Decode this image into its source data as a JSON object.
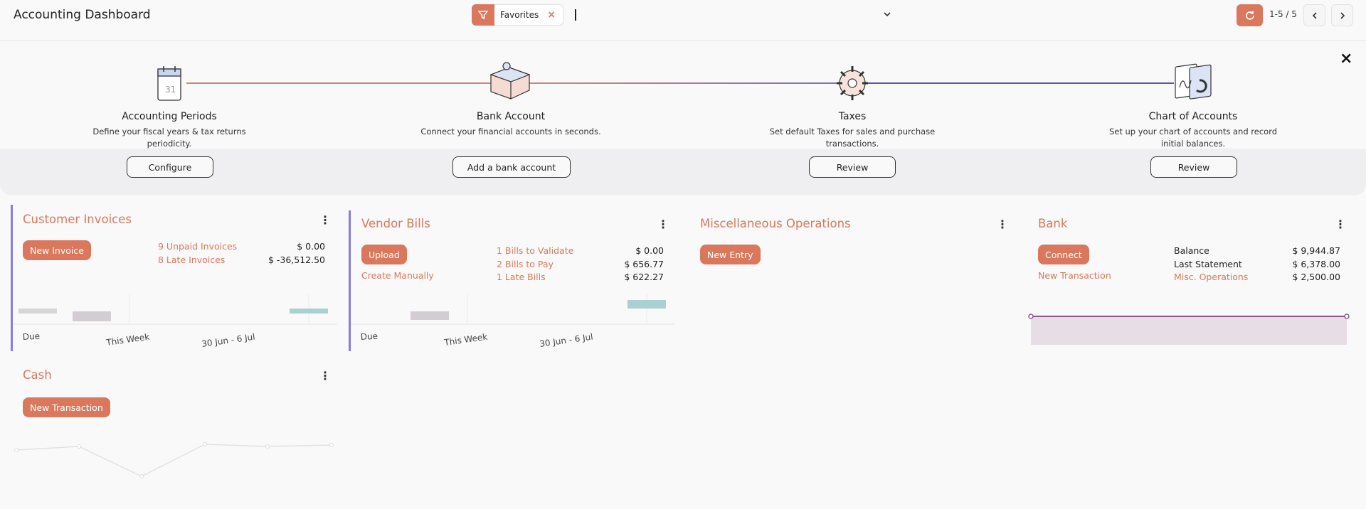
{
  "header": {
    "title": "Accounting Dashboard",
    "facet_label": "Favorites",
    "facet_remove": "×",
    "pager_value": "1-5 / 5"
  },
  "onboarding": {
    "close": "×",
    "steps": [
      {
        "title": "Accounting Periods",
        "desc": "Define your fiscal years & tax returns periodicity.",
        "button": "Configure"
      },
      {
        "title": "Bank Account",
        "desc": "Connect your financial accounts in seconds.",
        "button": "Add a bank account"
      },
      {
        "title": "Taxes",
        "desc": "Set default Taxes for sales and purchase transactions.",
        "button": "Review"
      },
      {
        "title": "Chart of Accounts",
        "desc": "Set up your chart of accounts and record initial balances.",
        "button": "Review"
      }
    ],
    "calendar_day": "31"
  },
  "journals": {
    "customer_invoices": {
      "title": "Customer Invoices",
      "button": "New Invoice",
      "rows": [
        {
          "label": "9 Unpaid Invoices",
          "amount": "$ 0.00"
        },
        {
          "label": "8 Late Invoices",
          "amount": "$ -36,512.50"
        }
      ],
      "graph_labels": [
        "Due",
        "This Week",
        "30 Jun - 6 Jul"
      ]
    },
    "vendor_bills": {
      "title": "Vendor Bills",
      "button": "Upload",
      "secondary": "Create Manually",
      "rows": [
        {
          "label": "1 Bills to Validate",
          "amount": "$ 0.00"
        },
        {
          "label": "2 Bills to Pay",
          "amount": "$ 656.77"
        },
        {
          "label": "1 Late Bills",
          "amount": "$ 622.27"
        }
      ],
      "graph_labels": [
        "Due",
        "This Week",
        "30 Jun - 6 Jul"
      ]
    },
    "misc_operations": {
      "title": "Miscellaneous Operations",
      "button": "New Entry"
    },
    "bank": {
      "title": "Bank",
      "button": "Connect",
      "secondary": "New Transaction",
      "rows": [
        {
          "label": "Balance",
          "amount": "$ 9,944.87"
        },
        {
          "label": "Last Statement",
          "amount": "$ 6,378.00"
        },
        {
          "label": "Misc. Operations",
          "amount": "$ 2,500.00"
        }
      ]
    },
    "cash": {
      "title": "Cash",
      "button": "New Transaction"
    }
  },
  "colors": {
    "accent": "#d9785c",
    "journal_bar": "#8a7bdc",
    "bank_graph_line": "#8b5a8c",
    "bank_graph_fill": "#e6dde5"
  }
}
